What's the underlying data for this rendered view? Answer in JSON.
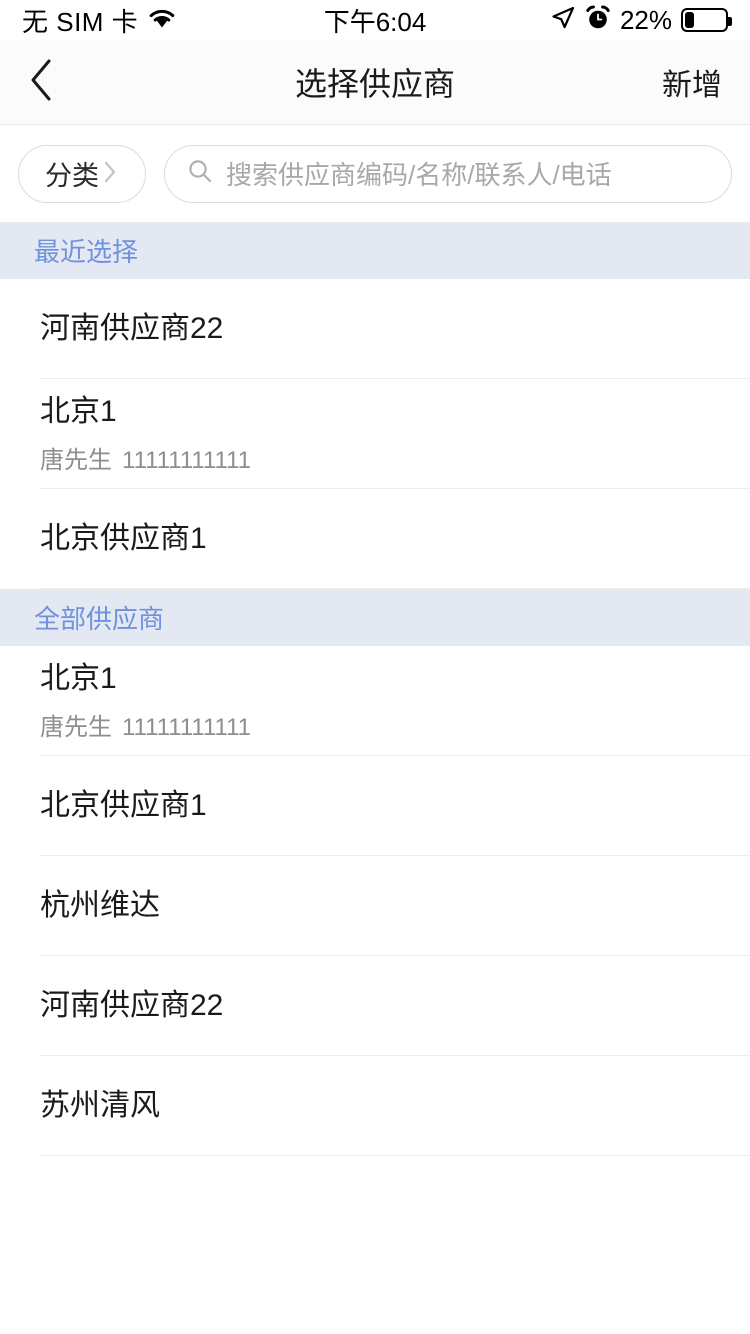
{
  "status_bar": {
    "carrier": "无 SIM 卡",
    "wifi_icon": "wifi-icon",
    "time": "下午6:04",
    "location_icon": "location-arrow-icon",
    "alarm_icon": "alarm-clock-icon",
    "battery_percent": "22%",
    "battery_level": 22
  },
  "nav_bar": {
    "back_icon": "chevron-left-icon",
    "title": "选择供应商",
    "action_label": "新增"
  },
  "search": {
    "category_label": "分类",
    "category_chevron_icon": "chevron-right-icon",
    "search_icon": "search-icon",
    "placeholder": "搜索供应商编码/名称/联系人/电话",
    "value": ""
  },
  "colors": {
    "section_header_bg": "#e4e8f2",
    "section_header_text": "#6e92dd",
    "row_title": "#1a1a1a",
    "row_sub": "#8e8e8e",
    "separator": "#ededed",
    "navbar_bg": "#fbfbfb"
  },
  "sections": [
    {
      "title": "最近选择",
      "rows": [
        {
          "name": "河南供应商22",
          "contact": "",
          "phone": ""
        },
        {
          "name": "北京1",
          "contact": "唐先生",
          "phone": "11111111111"
        },
        {
          "name": "北京供应商1",
          "contact": "",
          "phone": ""
        }
      ]
    },
    {
      "title": "全部供应商",
      "rows": [
        {
          "name": "北京1",
          "contact": "唐先生",
          "phone": "11111111111"
        },
        {
          "name": "北京供应商1",
          "contact": "",
          "phone": ""
        },
        {
          "name": "杭州维达",
          "contact": "",
          "phone": ""
        },
        {
          "name": "河南供应商22",
          "contact": "",
          "phone": ""
        },
        {
          "name": "苏州清风",
          "contact": "",
          "phone": ""
        }
      ]
    }
  ]
}
